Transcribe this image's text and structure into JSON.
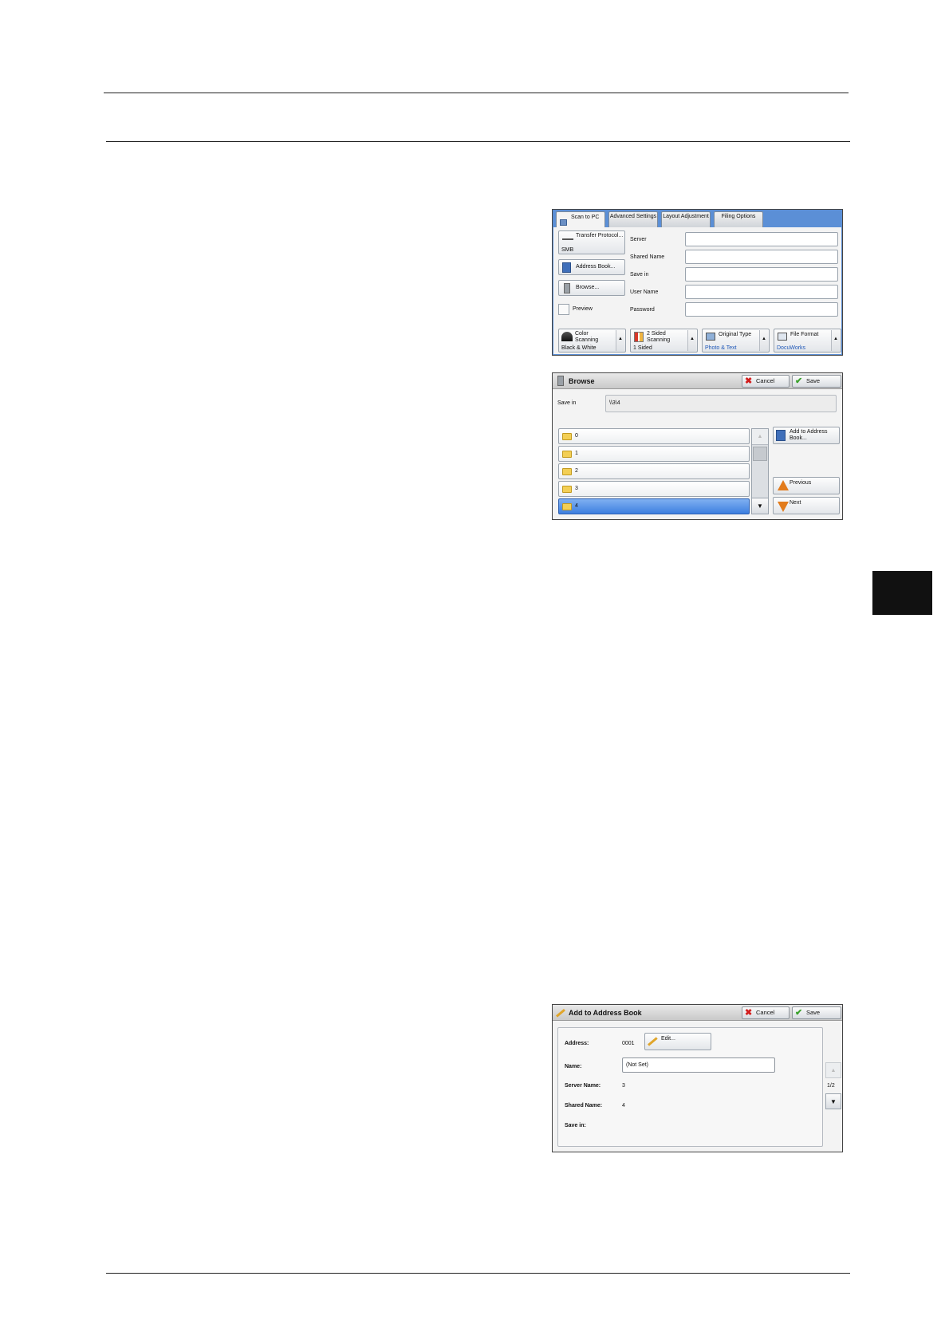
{
  "scan_to_pc": {
    "tabs": [
      "Scan to PC",
      "Advanced Settings",
      "Layout Adjustment",
      "Filing Options"
    ],
    "transfer_protocol": "Transfer Protocol...",
    "transfer_protocol_value": "SMB",
    "address_book": "Address Book...",
    "browse": "Browse...",
    "preview": "Preview",
    "fields": [
      "Server",
      "Shared Name",
      "Save in",
      "User Name",
      "Password"
    ],
    "bottom": [
      {
        "label": "Color Scanning",
        "value": "Black & White"
      },
      {
        "label": "2 Sided Scanning",
        "value": "1 Sided"
      },
      {
        "label": "Original Type",
        "value": "Photo & Text"
      },
      {
        "label": "File Format",
        "value": "DocuWorks"
      }
    ]
  },
  "browse": {
    "title": "Browse",
    "cancel": "Cancel",
    "save": "Save",
    "save_in_label": "Save in",
    "save_in_value": "\\\\3\\4",
    "folders": [
      "0",
      "1",
      "2",
      "3",
      "4"
    ],
    "selected_index": 4,
    "add_to_address_book": "Add to Address Book...",
    "previous": "Previous",
    "next": "Next"
  },
  "add_to_address_book": {
    "title": "Add to Address Book",
    "cancel": "Cancel",
    "save": "Save",
    "address_label": "Address:",
    "address_value": "0001",
    "edit": "Edit...",
    "name_label": "Name:",
    "name_value": "(Not Set)",
    "server_name_label": "Server Name:",
    "server_name_value": "3",
    "shared_name_label": "Shared Name:",
    "shared_name_value": "4",
    "save_in_label": "Save in:",
    "page": "1/2"
  }
}
